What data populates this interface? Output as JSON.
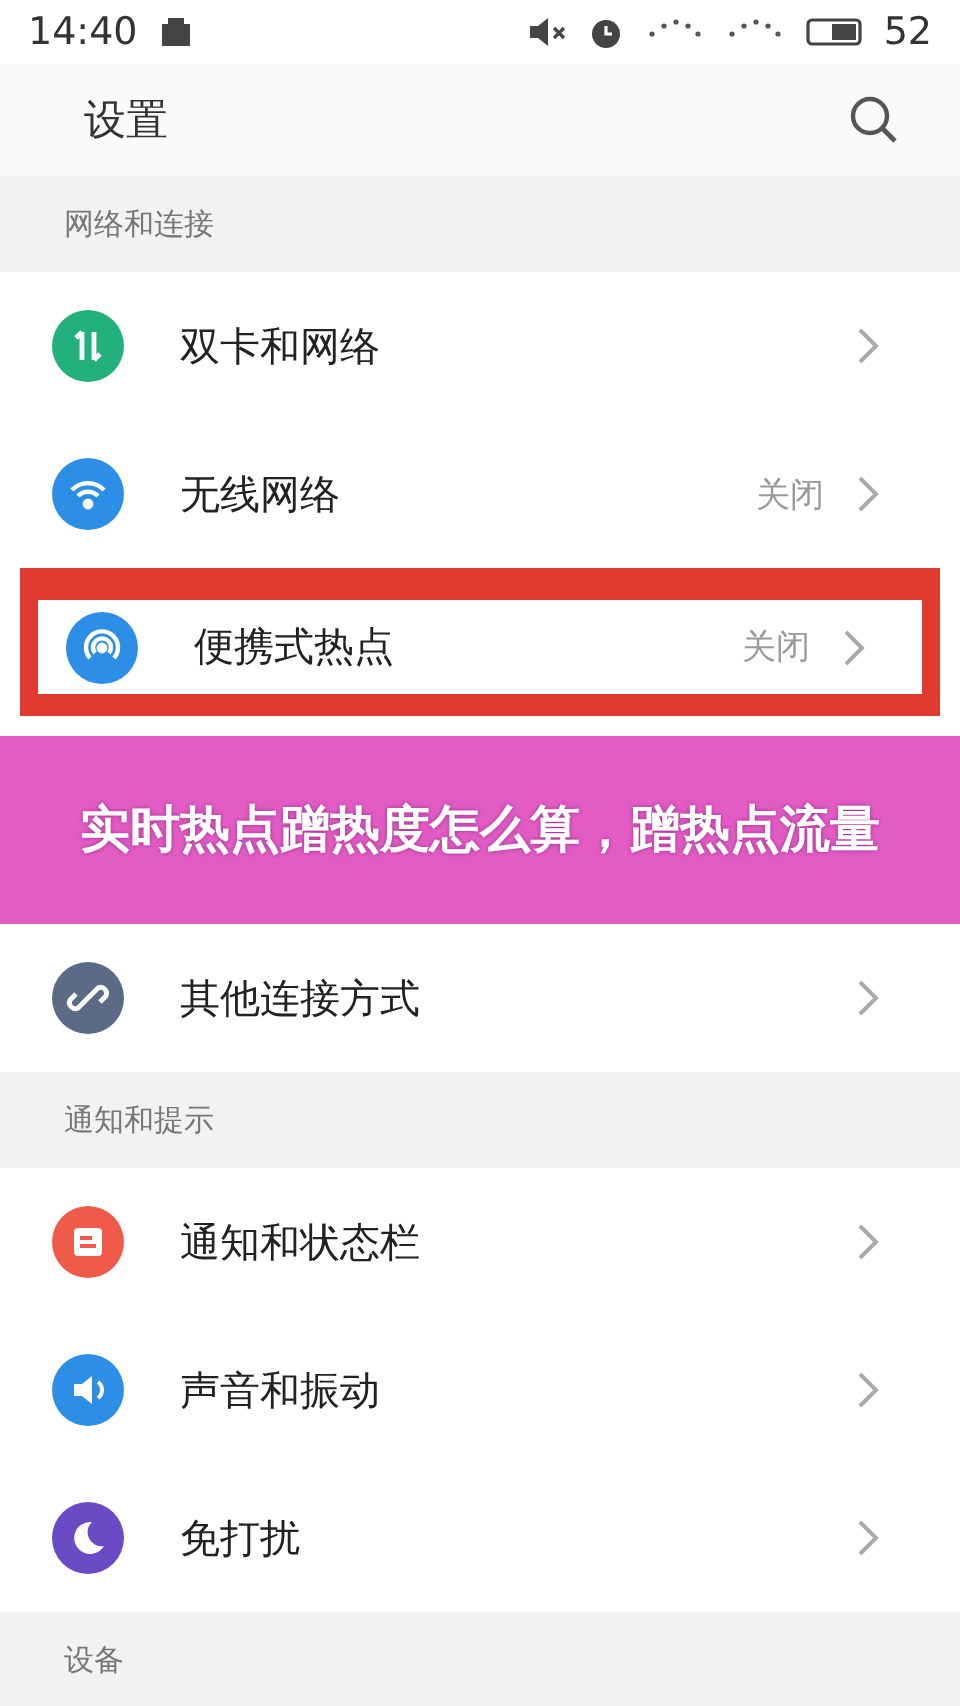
{
  "status_bar": {
    "time": "14:40",
    "battery": "52"
  },
  "header": {
    "title": "设置"
  },
  "sections": [
    {
      "title": "网络和连接",
      "items": [
        {
          "kind": "dualsim",
          "label": "双卡和网络",
          "highlighted": false
        },
        {
          "kind": "wifi",
          "label": "无线网络",
          "value": "关闭",
          "highlighted": false
        },
        {
          "kind": "hotspot",
          "label": "便携式热点",
          "value": "关闭",
          "highlighted": true
        },
        {
          "kind": "banner",
          "label": "实时热点蹭热度怎么算，蹭热点流量"
        },
        {
          "kind": "link",
          "label": "其他连接方式",
          "highlighted": false
        }
      ]
    },
    {
      "title": "通知和提示",
      "items": [
        {
          "kind": "notify",
          "label": "通知和状态栏",
          "highlighted": false
        },
        {
          "kind": "sound",
          "label": "声音和振动",
          "highlighted": false
        },
        {
          "kind": "dnd",
          "label": "免打扰",
          "highlighted": false
        }
      ]
    },
    {
      "title": "设备"
    }
  ]
}
